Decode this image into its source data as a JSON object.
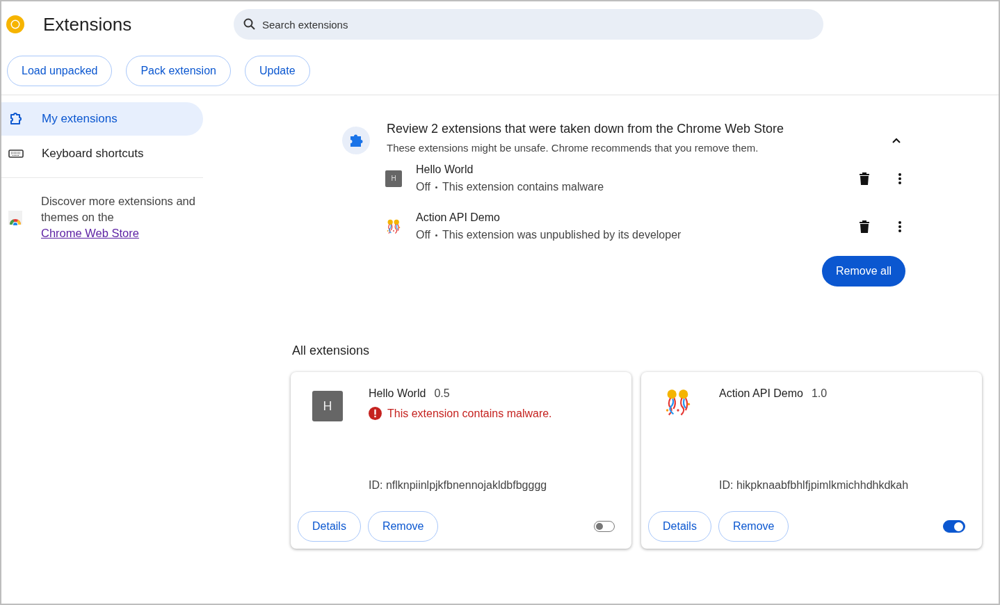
{
  "header": {
    "title": "Extensions",
    "search": {
      "placeholder": "Search extensions"
    }
  },
  "toolbar": {
    "buttons": [
      "Load unpacked",
      "Pack extension",
      "Update"
    ]
  },
  "sidebar": {
    "items": [
      {
        "label": "My extensions",
        "kind": "puzzle",
        "selected": true
      },
      {
        "label": "Keyboard shortcuts",
        "kind": "keyboard",
        "selected": false
      }
    ],
    "promo": {
      "text": "Discover more extensions and themes on the",
      "link": "Chrome Web Store"
    }
  },
  "review": {
    "title": "Review 2 extensions that were taken down from the Chrome Web Store",
    "subtitle": "These extensions might be unsafe. Chrome recommends that you remove them.",
    "expanded": true,
    "items": [
      {
        "name": "Hello World",
        "icon": {
          "kind": "letter",
          "letter": "H"
        },
        "status": "Off",
        "reason": "This extension contains malware"
      },
      {
        "name": "Action API Demo",
        "icon": {
          "kind": "confetti"
        },
        "status": "Off",
        "reason": "This extension was unpublished by its developer"
      }
    ],
    "remove_all": "Remove all"
  },
  "all_extensions": {
    "heading": "All extensions",
    "cards": [
      {
        "name": "Hello World",
        "version": "0.5",
        "icon": {
          "kind": "letter",
          "letter": "H"
        },
        "warning": "This extension contains malware.",
        "id": "ID: nflknpiinlpjkfbnennojakldbfbgggg",
        "details": "Details",
        "remove": "Remove",
        "on": false
      },
      {
        "name": "Action API Demo",
        "version": "1.0",
        "icon": {
          "kind": "confetti"
        },
        "id": "ID: hikpknaabfbhlfjpimlkmichhdhkdkah",
        "details": "Details",
        "remove": "Remove",
        "on": true
      }
    ]
  }
}
